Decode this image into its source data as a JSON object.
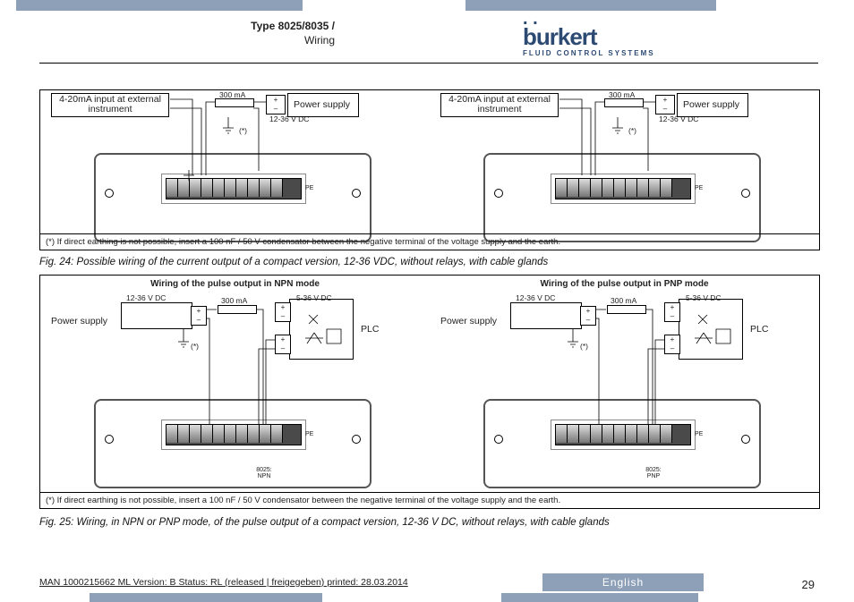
{
  "header": {
    "type_line": "Type 8025/8035 /",
    "subtitle": "Wiring"
  },
  "logo": {
    "brand": "burkert",
    "tagline": "FLUID CONTROL SYSTEMS"
  },
  "diagram1": {
    "input_label": "4-20mA input at external instrument",
    "psu_label": "Power supply",
    "fuse": "300 mA",
    "voltage": "12-36 V DC",
    "asterisk": "(*)",
    "pe": "PE",
    "footnote": "(*) If direct earthing is not possible, insert a 100 nF / 50 V condensator between  the negative terminal of the voltage supply and the earth."
  },
  "fig24": "Fig. 24:   Possible wiring of the current output of a compact version, 12-36 VDC, without relays, with cable glands",
  "diagram2": {
    "heading_npn": "Wiring of the pulse output in NPN mode",
    "heading_pnp": "Wiring of the pulse output in PNP mode",
    "psu_label": "Power supply",
    "voltage": "12-36 V DC",
    "fuse": "300 mA",
    "plc_v": "5-36 V DC",
    "plc": "PLC",
    "asterisk": "(*)",
    "pe": "PE",
    "mode_npn": "8025: NPN",
    "mode_pnp": "8025: PNP",
    "footnote": "(*) If direct earthing is not possible, insert a 100 nF / 50 V condensator between  the negative terminal of the voltage supply and the earth."
  },
  "fig25": "Fig. 25:   Wiring, in NPN or PNP mode, of the pulse output of a compact version, 12-36 V DC, without relays, with cable glands",
  "footer": {
    "doc_id": "MAN  1000215662  ML  Version: B Status: RL (released | freigegeben)  printed: 28.03.2014",
    "lang": "English",
    "page": "29"
  }
}
